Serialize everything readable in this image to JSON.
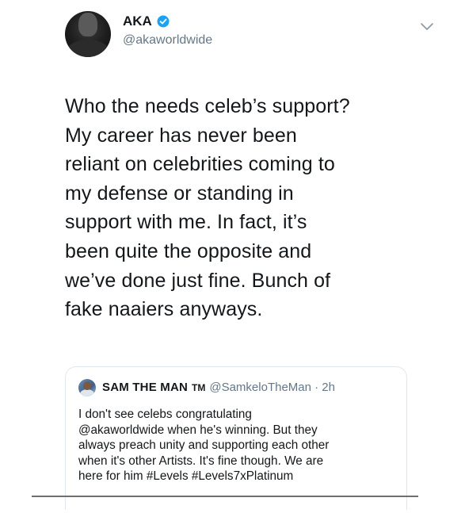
{
  "tweet": {
    "display_name": "AKA",
    "handle": "@akaworldwide",
    "verified": true,
    "text": "Who the needs celeb’s support?\nMy career has never been\nreliant on celebrities coming to\nmy defense or standing in\nsupport with me. In fact, it’s\nbeen quite the opposite and\nwe’ve done just fine. Bunch of\nfake naaiers anyways."
  },
  "quoted_tweet": {
    "display_name": "SAM THE MAN",
    "name_suffix": "TM",
    "handle_time": "@SamkeloTheMan · 2h",
    "text": "I don't see celebs congratulating\n@akaworldwide when he's winning. But they\nalways preach unity and supporting each other\nwhen it's other Artists. It's fine though. We are\nhere for him #Levels #Levels7xPlatinum"
  },
  "icons": {
    "verified": "verified-badge-icon",
    "menu": "chevron-down-icon"
  },
  "colors": {
    "verified_blue": "#1da1f2",
    "secondary_text": "#657786",
    "primary_text": "#14171a",
    "card_border": "#e1e8ed"
  }
}
